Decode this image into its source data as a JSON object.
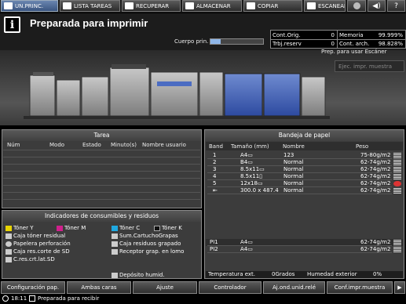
{
  "tabs": [
    {
      "label": "UN.PRINC."
    },
    {
      "label": "LISTA TAREAS"
    },
    {
      "label": "RECUPERAR"
    },
    {
      "label": "ALMACENAR"
    },
    {
      "label": "COPIAR"
    },
    {
      "label": "ESCANEAR"
    }
  ],
  "header": {
    "title": "Preparada para imprimir",
    "info_icon": "i",
    "cuerpo_label": "Cuerpo prin.",
    "cuerpo_level": 0.2
  },
  "counters": {
    "cont_orig_label": "Cont.Orig.",
    "cont_orig_value": "0",
    "memoria_label": "Memoria",
    "memoria_value": "99.999%",
    "trbj_label": "Trbj.reserv",
    "trbj_value": "0",
    "cont_arch_label": "Cont. arch.",
    "cont_arch_value": "98.828%"
  },
  "machine": {
    "prep_label": "Prep. para usar Escáner",
    "ejec_button": "Ejec. impr. muestra"
  },
  "tarea": {
    "title": "Tarea",
    "columns": [
      "Núm",
      "Modo",
      "Estado",
      "Minuto(s)",
      "Nombre usuario"
    ]
  },
  "consumibles": {
    "title": "Indicadores de consumibles y residuos",
    "items": [
      {
        "label": "Tóner Y",
        "icon": "toner-icon"
      },
      {
        "label": "Tóner M",
        "icon": "toner-icon"
      },
      {
        "label": "Tóner C",
        "icon": "toner-icon"
      },
      {
        "label": "Tóner K",
        "icon": "toner-icon"
      },
      {
        "label": "Caja tóner residual",
        "icon": "waste-box-icon"
      },
      {
        "label": "Sum.CartuchoGrapas",
        "icon": "staple-icon"
      },
      {
        "label": "Papelera perforación",
        "icon": "punch-icon"
      },
      {
        "label": "Caja residuos grapado",
        "icon": "staple-waste-icon"
      },
      {
        "label": "Caja res.corte de SD",
        "icon": "trim-box-icon"
      },
      {
        "label": "Receptor grap. en lomo",
        "icon": "spine-icon"
      },
      {
        "label": "C.res.crt.lat.SD",
        "icon": "trim-box-icon"
      },
      {
        "label": "Depósito humid.",
        "icon": "humid-tank-icon"
      }
    ],
    "toner_colors": [
      "#e8d400",
      "#d0208c",
      "#1fa8e0",
      "#111111"
    ]
  },
  "bandeja": {
    "title": "Bandeja de papel",
    "columns": [
      "Band",
      "Tamaño (mm)",
      "Nombre",
      "Peso"
    ],
    "rows": [
      {
        "band": "1",
        "size": "A4▭",
        "name": "123",
        "weight": "75-80g/m2",
        "level": "full"
      },
      {
        "band": "2",
        "size": "B4▭",
        "name": "Normal",
        "weight": "62-74g/m2",
        "level": "full"
      },
      {
        "band": "3",
        "size": "8.5x11▭",
        "name": "Normal",
        "weight": "62-74g/m2",
        "level": "full"
      },
      {
        "band": "4",
        "size": "8.5x11▯",
        "name": "Normal",
        "weight": "62-74g/m2",
        "level": "full"
      },
      {
        "band": "5",
        "size": "12x18▭",
        "name": "Normal",
        "weight": "62-74g/m2",
        "level": "warning"
      },
      {
        "band": "⇤",
        "size": "300.0 x 487.4",
        "name": "Normal",
        "weight": "62-74g/m2",
        "level": "full"
      }
    ],
    "pi_rows": [
      {
        "band": "PI1",
        "size": "A4▭",
        "name": "",
        "weight": "62-74g/m2"
      },
      {
        "band": "PI2",
        "size": "A4▭",
        "name": "",
        "weight": "62-74g/m2"
      }
    ],
    "temp_label": "Temperatura ext.",
    "temp_value": "0Grados",
    "hum_label": "Humedad exterior",
    "hum_value": "0%"
  },
  "bottom_buttons": [
    "Configuración pap.",
    "Ambas caras",
    "Ajuste",
    "Controlador",
    "Aj.ond.unid.relé",
    "Conf.impr.muestra"
  ],
  "status": {
    "time": "18:11",
    "message": "Preparada para recibir"
  }
}
